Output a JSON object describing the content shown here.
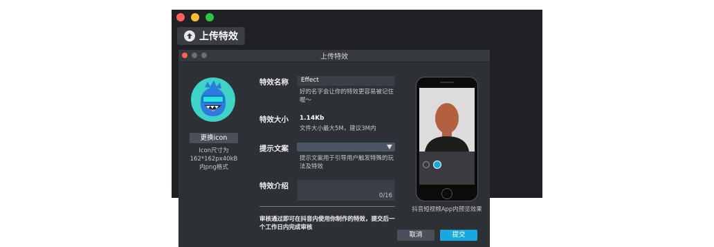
{
  "window": {
    "title": "上传特效"
  },
  "toolbar": {
    "upload_label": "上传特效"
  },
  "dialog": {
    "title": "上传特效",
    "change_icon_label": "更换icon",
    "icon_size_note": [
      "Icon尺寸为",
      "162*162px40kB",
      "内png格式"
    ],
    "fields": {
      "name_label": "特效名称",
      "name_value": "Effect",
      "name_hint": [
        "好的名字会让你的特效更容易被记住",
        "喔～"
      ],
      "size_label": "特效大小",
      "size_value": "1.14Kb",
      "size_hint": "文件大小最大5M，建议3M内",
      "prompt_label": "提示文案",
      "prompt_hint": [
        "提示文案用于引导用户触发特殊的玩",
        "法及特效"
      ],
      "intro_label": "特效介绍",
      "intro_counter": "0/16"
    },
    "review_note": [
      "审核通过即可在抖音内使用你制作的特效，提交后一",
      "个工作日内完成审核"
    ],
    "preview_caption": "抖音短视频App内预览效果",
    "cancel_label": "取消",
    "submit_label": "提交"
  },
  "colors": {
    "traffic_red": "#fe5f57",
    "traffic_yellow": "#febc2e",
    "traffic_green": "#28c840",
    "submit_blue": "#1aa7e0",
    "avatar_bg": "#3fd3c8"
  },
  "icons": [
    "arrow-up-circle-icon",
    "dropdown-arrow-icon",
    "emoji-icon",
    "sticker-icon"
  ]
}
